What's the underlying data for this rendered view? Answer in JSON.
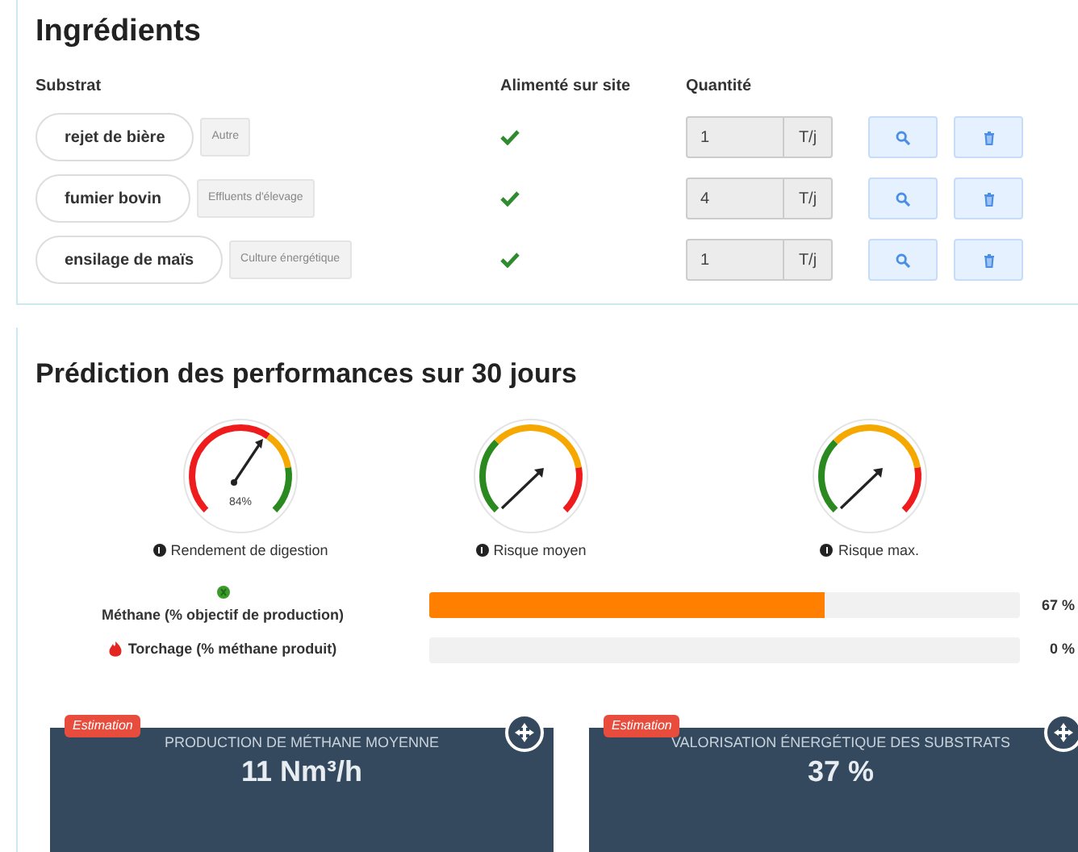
{
  "ingredients": {
    "title": "Ingrédients",
    "columns": [
      "Substrat",
      "Alimenté sur site",
      "Quantité"
    ],
    "rows": [
      {
        "name": "rejet de bière",
        "category": "Autre",
        "fed_on_site": true,
        "quantity": "1",
        "unit": "T/j"
      },
      {
        "name": "fumier bovin",
        "category": "Effluents d'élevage",
        "fed_on_site": true,
        "quantity": "4",
        "unit": "T/j"
      },
      {
        "name": "ensilage de maïs",
        "category": "Culture énergétique",
        "fed_on_site": true,
        "quantity": "1",
        "unit": "T/j"
      }
    ]
  },
  "prediction": {
    "title": "Prédiction des performances sur 30 jours",
    "gauges": [
      {
        "kind": "yield",
        "label": "Rendement de digestion",
        "reading": "84%"
      },
      {
        "kind": "risk",
        "label": "Risque moyen"
      },
      {
        "kind": "risk",
        "label": "Risque max."
      }
    ],
    "bars": [
      {
        "kind": "methane",
        "label": "Méthane (% objectif de production)",
        "level": 0.67,
        "reading": "67 %"
      },
      {
        "kind": "flare",
        "label": "Torchage (% méthane produit)",
        "reading": "0 %"
      }
    ],
    "kpis": [
      {
        "badge": "Estimation",
        "title": "PRODUCTION DE MÉTHANE MOYENNE",
        "value": "11 Nm³/h"
      },
      {
        "badge": "Estimation",
        "title": "VALORISATION ÉNERGÉTIQUE DES SUBSTRATS",
        "value": "37 %"
      }
    ]
  }
}
